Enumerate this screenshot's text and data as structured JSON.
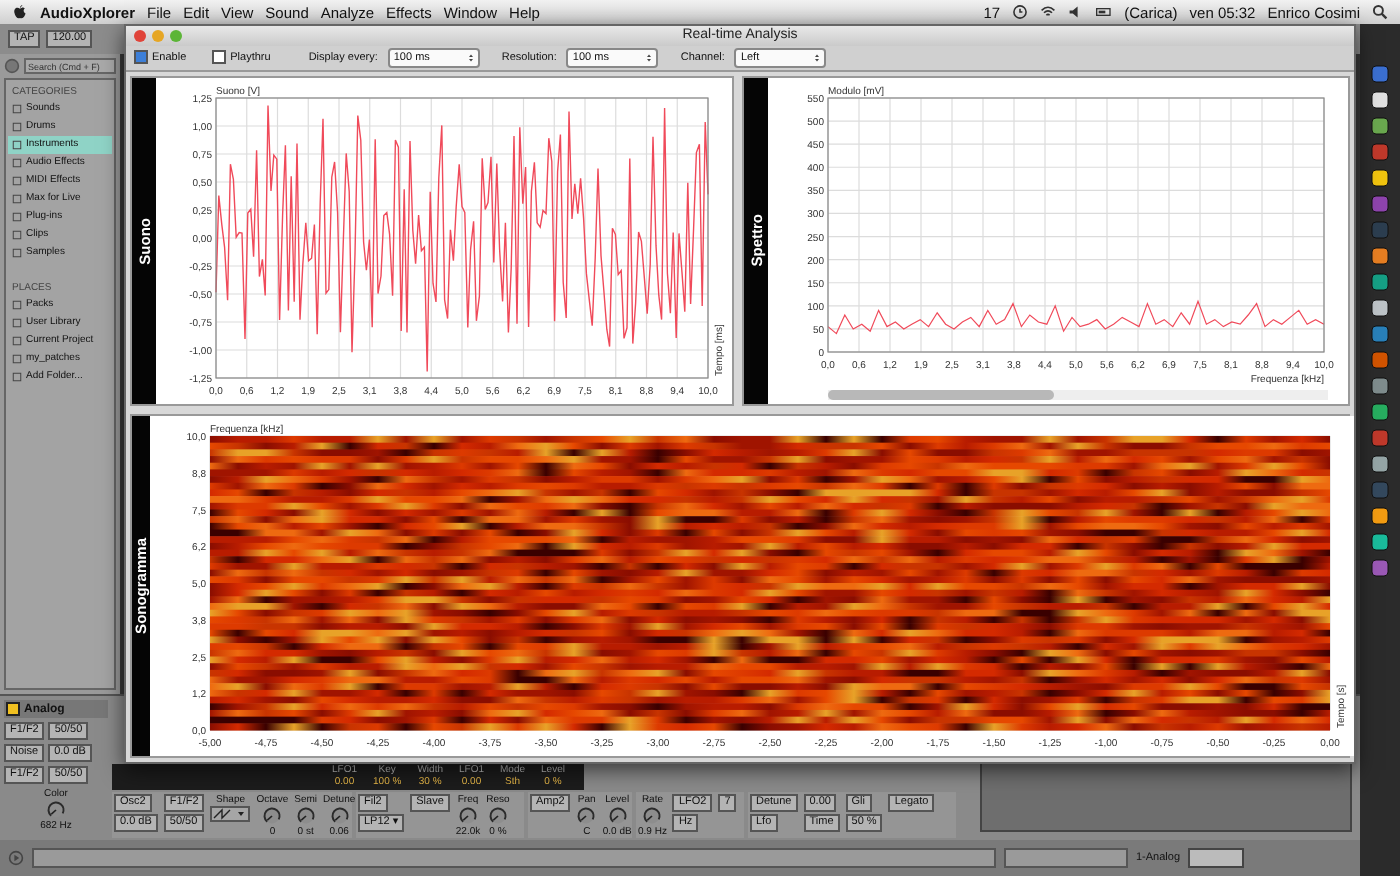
{
  "menu_bar": {
    "app_name": "AudioXplorer",
    "menus": [
      "File",
      "Edit",
      "View",
      "Sound",
      "Analyze",
      "Effects",
      "Window",
      "Help"
    ],
    "badge": "17",
    "battery": "(Carica)",
    "clock": "ven 05:32",
    "user": "Enrico Cosimi"
  },
  "browser": {
    "tap": "TAP",
    "tempo": "120.00",
    "search": {
      "placeholder": "Search (Cmd + F)"
    },
    "sections": [
      {
        "title": "CATEGORIES",
        "items": [
          {
            "label": "Sounds",
            "selected": false
          },
          {
            "label": "Drums",
            "selected": false
          },
          {
            "label": "Instruments",
            "selected": true
          },
          {
            "label": "Audio Effects",
            "selected": false
          },
          {
            "label": "MIDI Effects",
            "selected": false
          },
          {
            "label": "Max for Live",
            "selected": false
          },
          {
            "label": "Plug-ins",
            "selected": false
          },
          {
            "label": "Clips",
            "selected": false
          },
          {
            "label": "Samples",
            "selected": false
          }
        ]
      },
      {
        "title": "PLACES",
        "items": [
          {
            "label": "Packs",
            "selected": false
          },
          {
            "label": "User Library",
            "selected": false
          },
          {
            "label": "Current Project",
            "selected": false
          },
          {
            "label": "my_patches",
            "selected": false
          },
          {
            "label": "Add Folder...",
            "selected": false
          }
        ]
      }
    ]
  },
  "window": {
    "title": "Real-time Analysis",
    "enable": {
      "label": "Enable",
      "checked": true
    },
    "playthru": {
      "label": "Playthru",
      "checked": false
    },
    "selects": [
      {
        "label": "Display every:",
        "value": "100 ms"
      },
      {
        "label": "Resolution:",
        "value": "100 ms"
      },
      {
        "label": "Channel:",
        "value": "Left"
      }
    ],
    "panels": [
      {
        "kind": "wave",
        "title": "Suono",
        "y_title": "Suono [V]",
        "x_title": "Tempo [ms]",
        "y_labels": [
          "1,25",
          "1,00",
          "0,75",
          "0,50",
          "0,25",
          "0,00",
          "-0,25",
          "-0,50",
          "-0,75",
          "-1,00",
          "-1,25"
        ],
        "x_labels": [
          "0,0",
          "0,6",
          "1,2",
          "1,9",
          "2,5",
          "3,1",
          "3,8",
          "4,4",
          "5,0",
          "5,6",
          "6,2",
          "6,9",
          "7,5",
          "8,1",
          "8,8",
          "9,4",
          "10,0"
        ]
      },
      {
        "kind": "spectrum",
        "title": "Spettro",
        "chart_data": {
          "type": "line",
          "xlabel": "Frequenza [kHz]",
          "ylabel": "Modulo [mV]",
          "grid": true,
          "xlim": [
            0,
            10
          ],
          "ylim": [
            0,
            550
          ],
          "yticks": [
            0,
            50,
            100,
            150,
            200,
            250,
            300,
            350,
            400,
            450,
            500,
            550
          ],
          "xticks": [
            {
              "value": 0,
              "label": "0,0"
            },
            {
              "value": 0.625,
              "label": "0,6"
            },
            {
              "value": 1.25,
              "label": "1,2"
            },
            {
              "value": 1.875,
              "label": "1,9"
            },
            {
              "value": 2.5,
              "label": "2,5"
            },
            {
              "value": 3.125,
              "label": "3,1"
            },
            {
              "value": 3.75,
              "label": "3,8"
            },
            {
              "value": 4.375,
              "label": "4,4"
            },
            {
              "value": 5,
              "label": "5,0"
            },
            {
              "value": 5.625,
              "label": "5,6"
            },
            {
              "value": 6.25,
              "label": "6,2"
            },
            {
              "value": 6.875,
              "label": "6,9"
            },
            {
              "value": 7.5,
              "label": "7,5"
            },
            {
              "value": 8.125,
              "label": "8,1"
            },
            {
              "value": 8.75,
              "label": "8,8"
            },
            {
              "value": 9.375,
              "label": "9,4"
            },
            {
              "value": 10,
              "label": "10,0"
            }
          ],
          "x": [
            0,
            0.17,
            0.34,
            0.51,
            0.68,
            0.85,
            1.02,
            1.19,
            1.36,
            1.53,
            1.69,
            1.86,
            2.03,
            2.2,
            2.37,
            2.54,
            2.71,
            2.88,
            3.05,
            3.22,
            3.39,
            3.56,
            3.73,
            3.9,
            4.07,
            4.24,
            4.41,
            4.58,
            4.75,
            4.92,
            5.08,
            5.25,
            5.42,
            5.59,
            5.76,
            5.93,
            6.1,
            6.27,
            6.44,
            6.61,
            6.78,
            6.95,
            7.12,
            7.29,
            7.46,
            7.63,
            7.8,
            7.97,
            8.14,
            8.31,
            8.47,
            8.64,
            8.81,
            8.98,
            9.15,
            9.32,
            9.49,
            9.66,
            9.83,
            10
          ],
          "series": [
            {
              "color": "#f04a5a",
              "values": [
                55,
                40,
                80,
                50,
                60,
                45,
                90,
                55,
                65,
                50,
                60,
                70,
                55,
                85,
                60,
                50,
                65,
                75,
                55,
                90,
                60,
                70,
                105,
                55,
                80,
                65,
                60,
                100,
                45,
                75,
                55,
                60,
                70,
                50,
                60,
                75,
                65,
                55,
                105,
                60,
                70,
                55,
                85,
                60,
                110,
                60,
                70,
                55,
                65,
                60,
                80,
                105,
                55,
                70,
                60,
                75,
                90,
                60,
                70,
                60
              ]
            }
          ]
        }
      },
      {
        "kind": "sonogram",
        "title": "Sonogramma",
        "y_title": "Frequenza [kHz]",
        "x_title": "Tempo [s]",
        "y_labels": [
          "10,0",
          "8,8",
          "7,5",
          "6,2",
          "5,0",
          "3,8",
          "2,5",
          "1,2",
          "0,0"
        ],
        "x_labels": [
          "-5,00",
          "-4,75",
          "-4,50",
          "-4,25",
          "-4,00",
          "-3,75",
          "-3,50",
          "-3,25",
          "-3,00",
          "-2,75",
          "-2,50",
          "-2,25",
          "-2,00",
          "-1,75",
          "-1,50",
          "-1,25",
          "-1,00",
          "-0,75",
          "-0,50",
          "-0,25",
          "0,00"
        ]
      }
    ]
  },
  "device": {
    "title": "Analog",
    "on": true,
    "side": [
      {
        "label": "F1/F2",
        "value": "50/50"
      },
      {
        "label": "Noise",
        "value": "0.0 dB"
      },
      {
        "label": "F1/F2",
        "value": "50/50"
      }
    ],
    "color_knob": {
      "label": "Color",
      "value": "682 Hz"
    },
    "readout": [
      {
        "label": "LFO1",
        "value": "0.00"
      },
      {
        "label": "Key",
        "value": "100 %"
      },
      {
        "label": "Width",
        "value": "30 %"
      },
      {
        "label": "LFO1",
        "value": "0.00"
      },
      {
        "label": "Mode",
        "value": "Sth"
      },
      {
        "label": "Level",
        "value": "0 %"
      }
    ],
    "groups": [
      {
        "items": [
          {
            "kind": "chip",
            "text": "Osc2"
          },
          {
            "kind": "chip",
            "text": "0.0 dB"
          },
          {
            "kind": "chip",
            "text": "F1/F2"
          },
          {
            "kind": "chip",
            "text": "50/50"
          },
          {
            "kind": "shape",
            "label": "Shape"
          },
          {
            "kind": "knob",
            "label": "Octave",
            "value": "0"
          },
          {
            "kind": "knob",
            "label": "Semi",
            "value": "0 st"
          },
          {
            "kind": "knob",
            "label": "Detune",
            "value": "0.06"
          }
        ]
      },
      {
        "items": [
          {
            "kind": "chip",
            "text": "Fil2"
          },
          {
            "kind": "chip",
            "text": "LP12 ▾"
          },
          {
            "kind": "chip",
            "text": "Slave"
          },
          {
            "kind": "knob",
            "label": "Freq",
            "value": "22.0k"
          },
          {
            "kind": "knob",
            "label": "Reso",
            "value": "0 %"
          }
        ]
      },
      {
        "items": [
          {
            "kind": "chip",
            "text": "Amp2"
          },
          {
            "kind": "knob",
            "label": "Pan",
            "value": "C"
          },
          {
            "kind": "knob",
            "label": "Level",
            "value": "0.0 dB"
          }
        ]
      },
      {
        "items": [
          {
            "kind": "knob",
            "label": "Rate",
            "value": "0.9 Hz"
          },
          {
            "kind": "chip",
            "text": "LFO2"
          },
          {
            "kind": "chip",
            "text": "Hz"
          },
          {
            "kind": "chip",
            "text": "7"
          }
        ]
      },
      {
        "items": [
          {
            "kind": "chip",
            "text": "Detune"
          },
          {
            "kind": "chip",
            "text": "Lfo"
          },
          {
            "kind": "chip",
            "text": "0.00"
          },
          {
            "kind": "chip",
            "text": "Time"
          },
          {
            "kind": "chip",
            "text": "Gli"
          },
          {
            "kind": "chip",
            "text": "50 %"
          },
          {
            "kind": "chip",
            "text": "Legato"
          }
        ]
      }
    ]
  },
  "footer": {
    "track": "1-Analog"
  }
}
